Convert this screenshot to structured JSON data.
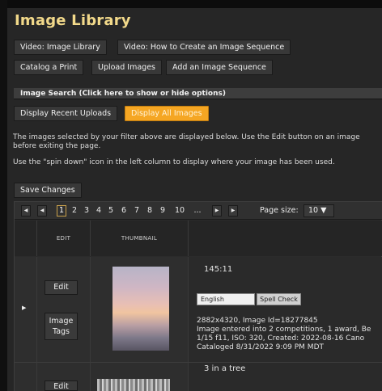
{
  "page": {
    "title": "Image Library"
  },
  "buttons": {
    "video_library": "Video: Image Library",
    "video_sequence": "Video: How to Create an Image Sequence",
    "catalog_print": "Catalog a Print",
    "upload_images": "Upload Images",
    "add_sequence": "Add an Image Sequence",
    "recent_uploads": "Display Recent Uploads",
    "all_images": "Display All Images",
    "save_changes": "Save Changes"
  },
  "search": {
    "header": "Image Search (Click here to show or hide options)"
  },
  "instructions": {
    "line1": "The images selected by your filter above are displayed below. Use the Edit button on an image",
    "line2": "before exiting the page.",
    "line3": "Use the \"spin down\" icon in the left column to display where your image has been used."
  },
  "pager": {
    "first_icon": "first-page-icon",
    "prev_icon": "prev-page-icon",
    "next_icon": "next-page-icon",
    "last_icon": "last-page-icon",
    "pages": [
      "1",
      "2",
      "3",
      "4",
      "5",
      "6",
      "7",
      "8",
      "9",
      "10",
      "..."
    ],
    "current": "1",
    "page_size_label": "Page size:",
    "page_size": "10 ▼"
  },
  "table": {
    "columns": {
      "edit": "EDIT",
      "thumbnail": "THUMBNAIL"
    },
    "rows": [
      {
        "edit": "Edit",
        "image_tags": [
          "Image",
          "Tags"
        ],
        "caption": "145:11",
        "language": "English",
        "spell_check": "Spell Check",
        "info1": "2882x4320, Image Id=18277845",
        "info2": "Image entered into 2 competitions, 1 award, Be",
        "info3": "1/15 f11, ISO: 320, Created: 2022-08-16 Cano",
        "info4": "Cataloged 8/31/2022 9:09 PM MDT"
      },
      {
        "edit": "Edit",
        "caption": "3 in a tree"
      }
    ]
  },
  "colors": {
    "title": "#f2d98a",
    "active_button": "#f5a623",
    "background": "#262626"
  }
}
